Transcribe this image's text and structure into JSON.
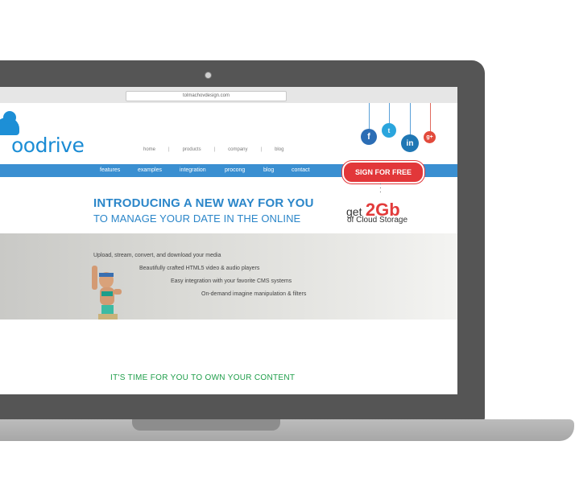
{
  "browser": {
    "url": "tolmachovdesign.com"
  },
  "logo": {
    "prefix": "oo",
    "word": "drive"
  },
  "topnav": {
    "items": [
      {
        "label": "home"
      },
      {
        "label": "products"
      },
      {
        "label": "company"
      },
      {
        "label": "blog"
      }
    ],
    "separator": "|"
  },
  "social": [
    {
      "name": "facebook-icon",
      "glyph": "f",
      "color": "#2b6db5"
    },
    {
      "name": "twitter-icon",
      "glyph": "t",
      "color": "#2aa5dd"
    },
    {
      "name": "linkedin-icon",
      "glyph": "in",
      "color": "#1f77b4"
    },
    {
      "name": "google-plus-icon",
      "glyph": "g+",
      "color": "#e24a3b"
    }
  ],
  "mainnav": {
    "items": [
      {
        "label": "features"
      },
      {
        "label": "examples"
      },
      {
        "label": "integration"
      },
      {
        "label": "procong"
      },
      {
        "label": "blog"
      },
      {
        "label": "contact"
      }
    ],
    "cta": "SIGN FOR FREE"
  },
  "hero": {
    "headline": "INTRODUCING A NEW WAY FOR YOU",
    "subheadline": "TO MANAGE YOUR DATE IN THE ONLINE",
    "offer_prefix": "get",
    "offer_amount": "2Gb",
    "offer_suffix": "of Cloud Storage"
  },
  "banner": {
    "features": [
      "Upload, stream, convert, and download your media",
      "Beautifully crafted HTML5 video & audio players",
      "Easy integration with your favorite CMS systems",
      "On-demand imagine manipulation & filters"
    ]
  },
  "tagline": "IT'S TIME FOR YOU TO OWN YOUR CONTENT",
  "colors": {
    "brand_blue": "#3a8fd1",
    "cta_red": "#e2373a",
    "tagline_green": "#1f9e4a",
    "laptop": "#555555"
  }
}
